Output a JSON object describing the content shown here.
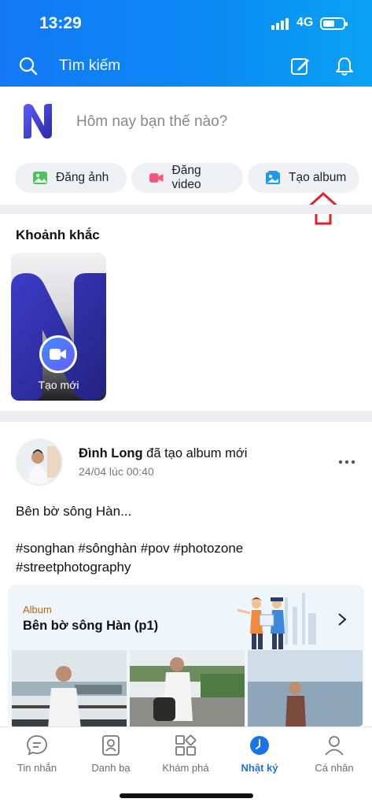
{
  "status_bar": {
    "time": "13:29",
    "network": "4G",
    "battery_level": 0.6
  },
  "header": {
    "search_label": "Tìm kiếm"
  },
  "composer": {
    "prompt": "Hôm nay bạn thế nào?",
    "actions": [
      {
        "label": "Đăng ảnh",
        "icon": "photo-icon"
      },
      {
        "label": "Đăng video",
        "icon": "video-icon"
      },
      {
        "label": "Tạo album",
        "icon": "album-icon"
      }
    ]
  },
  "moments": {
    "title": "Khoảnh khắc",
    "new_label": "Tạo mới"
  },
  "post": {
    "author": "Đình Long",
    "action": "đã tạo album mới",
    "time": "24/04 lúc 00:40",
    "text": "Bên bờ sông Hàn...",
    "tags_line1": "#songhan #sônghàn #pov #photozone",
    "tags_line2": "#streetphotography",
    "album": {
      "kicker": "Album",
      "name": "Bên bờ sông Hàn (p1)"
    }
  },
  "bottom_nav": [
    {
      "label": "Tin nhắn",
      "icon": "chat-icon"
    },
    {
      "label": "Danh bạ",
      "icon": "contacts-icon"
    },
    {
      "label": "Khám phá",
      "icon": "explore-icon"
    },
    {
      "label": "Nhật ký",
      "icon": "clock-icon",
      "active": true
    },
    {
      "label": "Cá nhân",
      "icon": "person-icon"
    }
  ],
  "colors": {
    "brand_blue": "#0a8cf5",
    "active_nav": "#1a73e8",
    "arrow_red": "#e0202a"
  }
}
